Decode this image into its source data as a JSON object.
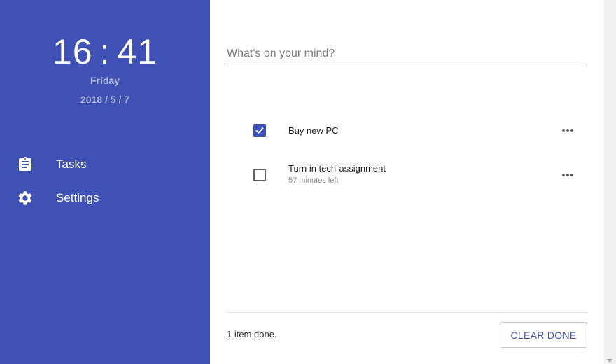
{
  "sidebar": {
    "clock": {
      "hours": "16",
      "separator": ":",
      "minutes": "41"
    },
    "day": "Friday",
    "date": "2018 / 5 / 7",
    "nav": [
      {
        "label": "Tasks",
        "icon": "clipboard-icon"
      },
      {
        "label": "Settings",
        "icon": "gear-icon"
      }
    ],
    "color": "#3f51b5"
  },
  "main": {
    "input_placeholder": "What's on your mind?",
    "tasks": [
      {
        "title": "Buy new PC",
        "done": true,
        "subtitle": ""
      },
      {
        "title": "Turn in tech-assignment",
        "done": false,
        "subtitle": "57 minutes left"
      }
    ],
    "footer": {
      "done_text": "1 item done.",
      "clear_label": "CLEAR DONE"
    }
  },
  "accent_color": "#3f51b5"
}
